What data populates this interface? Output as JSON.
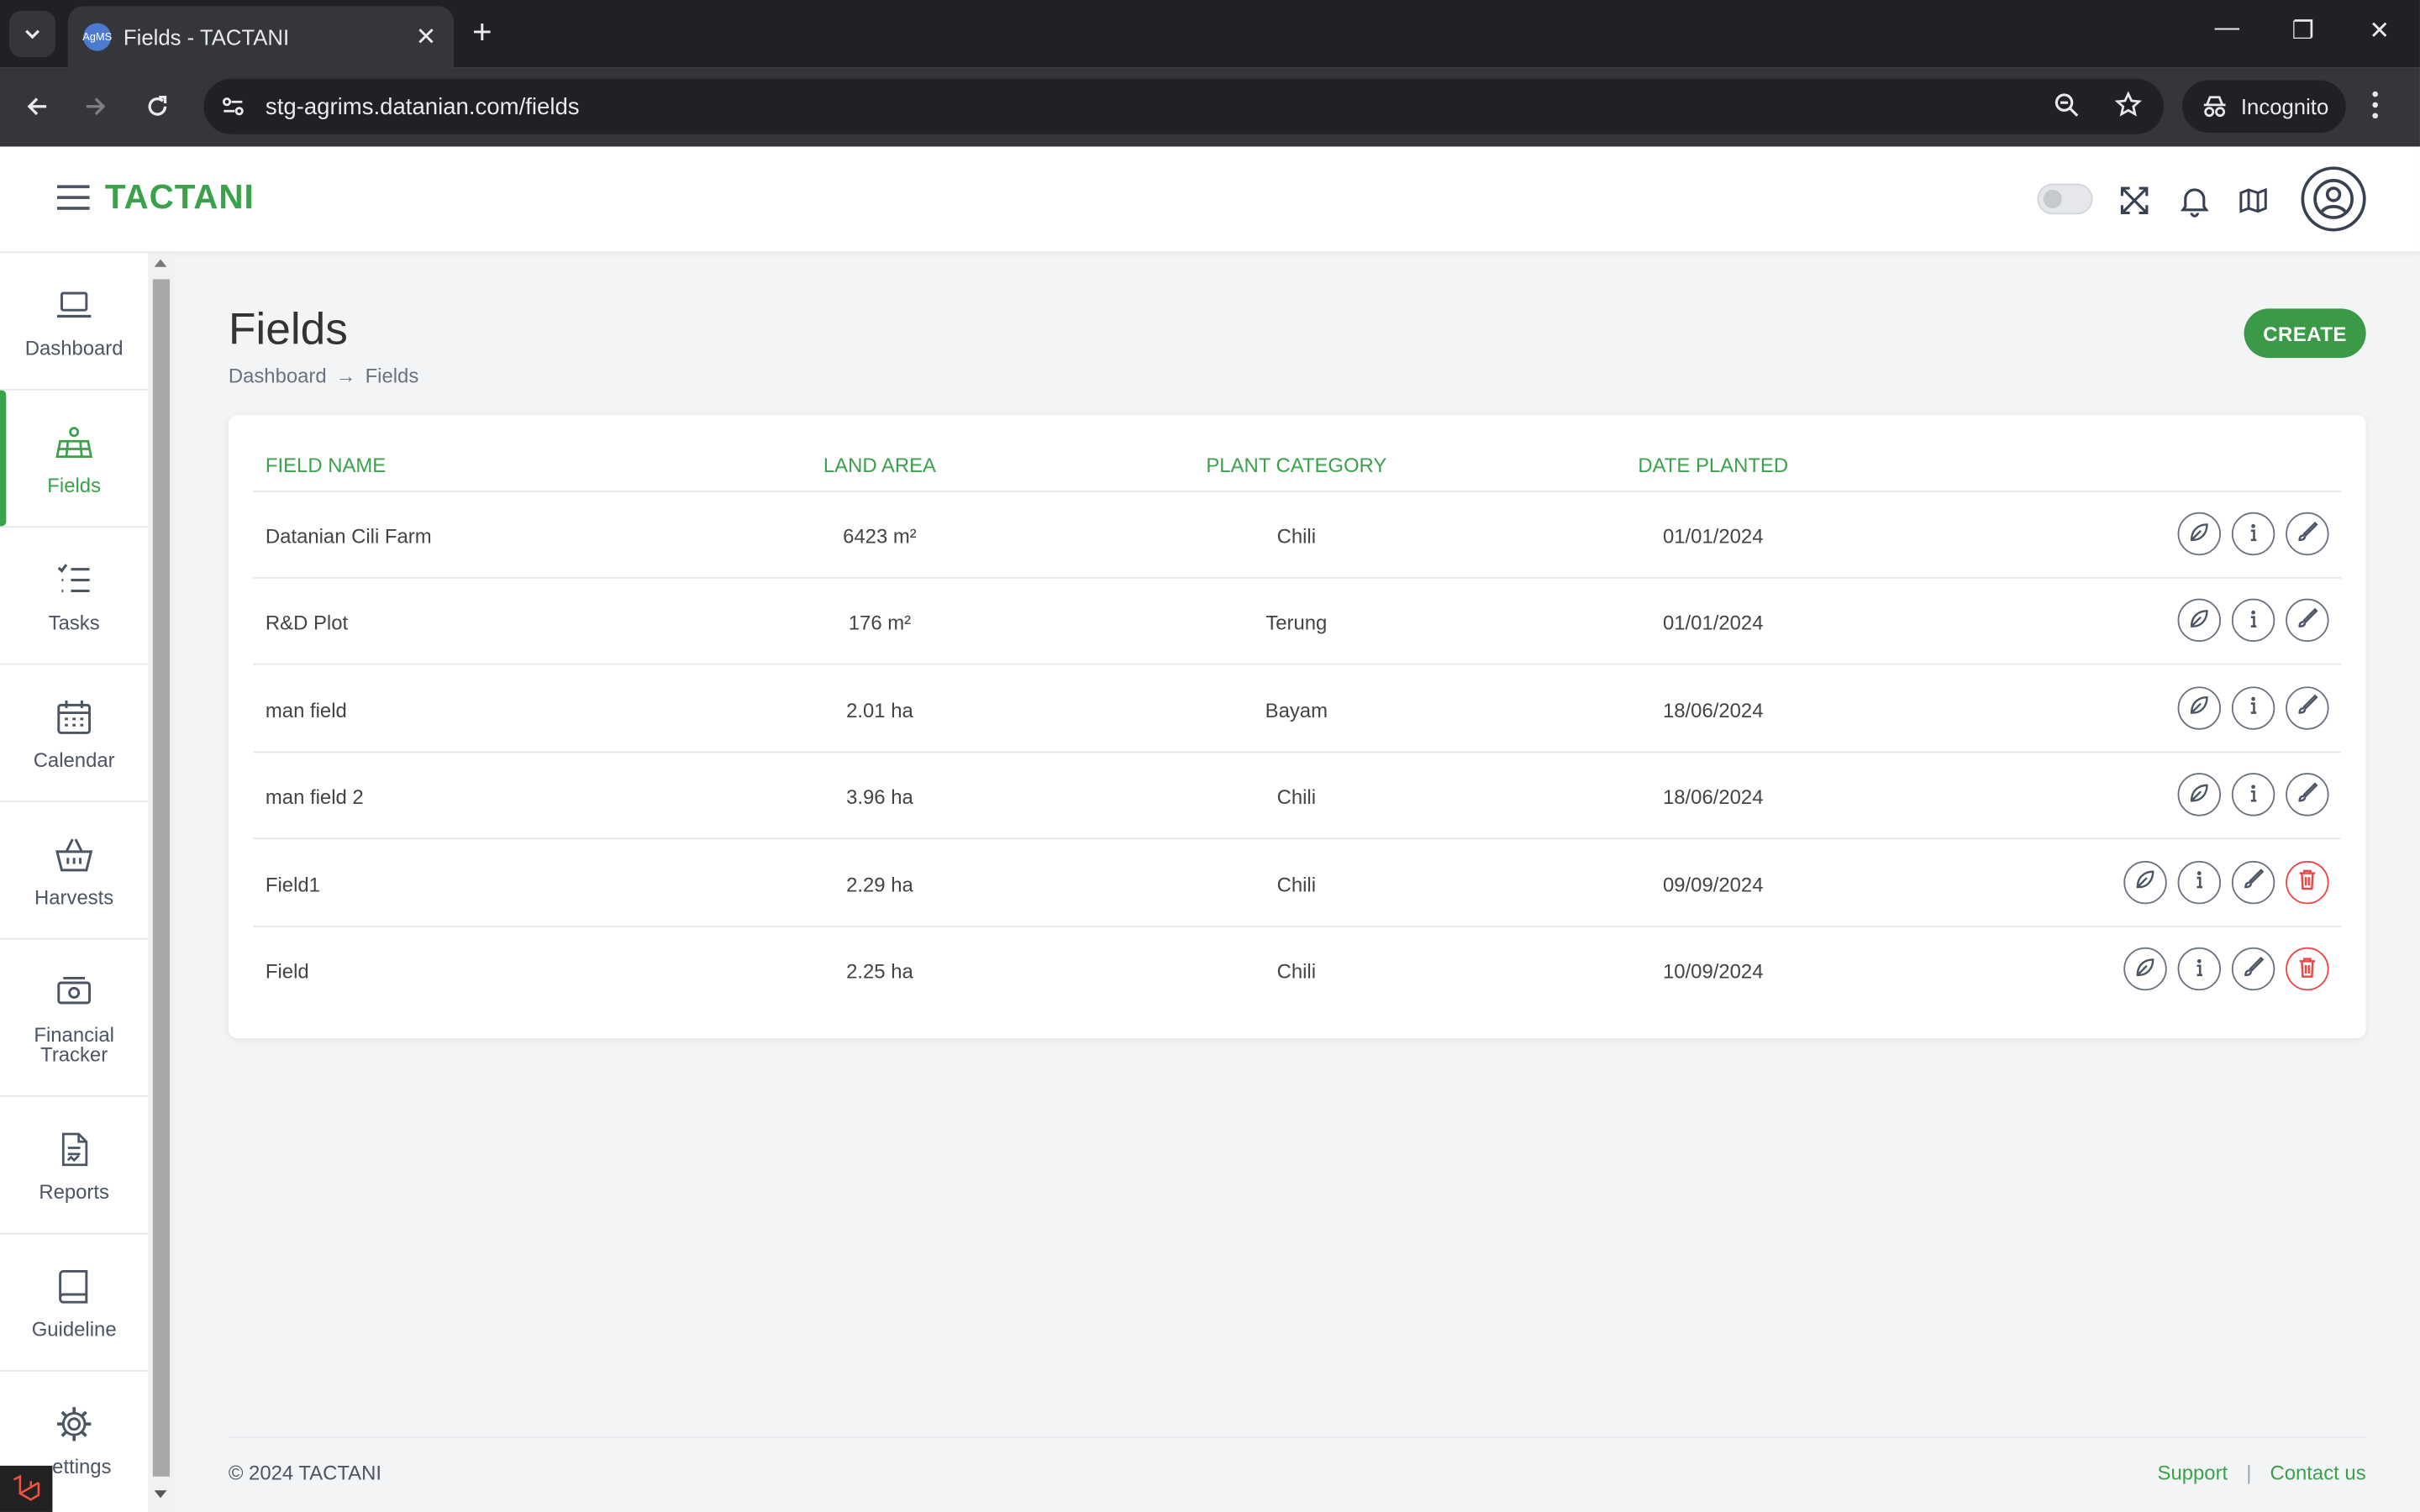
{
  "browser": {
    "tab_title": "Fields - TACTANI",
    "favicon_text": "AgMS",
    "url": "stg-agrims.datanian.com/fields",
    "incognito_label": "Incognito"
  },
  "app": {
    "brand": "TACTANI",
    "accent_color": "#3aa24a"
  },
  "sidebar": {
    "items": [
      {
        "label": "Dashboard",
        "icon": "laptop-icon"
      },
      {
        "label": "Fields",
        "icon": "field-icon",
        "active": true
      },
      {
        "label": "Tasks",
        "icon": "tasks-icon"
      },
      {
        "label": "Calendar",
        "icon": "calendar-icon"
      },
      {
        "label": "Harvests",
        "icon": "basket-icon"
      },
      {
        "label": "Financial Tracker",
        "icon": "money-icon"
      },
      {
        "label": "Reports",
        "icon": "report-icon"
      },
      {
        "label": "Guideline",
        "icon": "book-icon"
      },
      {
        "label": "ettings",
        "icon": "gear-icon"
      }
    ]
  },
  "page": {
    "title": "Fields",
    "breadcrumb": [
      "Dashboard",
      "Fields"
    ],
    "breadcrumb_sep": "→",
    "create_label": "CREATE"
  },
  "table": {
    "headers": [
      "FIELD NAME",
      "LAND AREA",
      "PLANT CATEGORY",
      "DATE PLANTED"
    ],
    "rows": [
      {
        "name": "Datanian Cili Farm",
        "area": "6423 m²",
        "category": "Chili",
        "date": "01/01/2024",
        "deletable": false
      },
      {
        "name": "R&D Plot",
        "area": "176 m²",
        "category": "Terung",
        "date": "01/01/2024",
        "deletable": false
      },
      {
        "name": "man field",
        "area": "2.01 ha",
        "category": "Bayam",
        "date": "18/06/2024",
        "deletable": false
      },
      {
        "name": "man field 2",
        "area": "3.96 ha",
        "category": "Chili",
        "date": "18/06/2024",
        "deletable": false
      },
      {
        "name": "Field1",
        "area": "2.29 ha",
        "category": "Chili",
        "date": "09/09/2024",
        "deletable": true
      },
      {
        "name": "Field",
        "area": "2.25 ha",
        "category": "Chili",
        "date": "10/09/2024",
        "deletable": true
      }
    ]
  },
  "footer": {
    "copyright": "© 2024 TACTANI",
    "support": "Support",
    "separator": "|",
    "contact": "Contact us"
  }
}
